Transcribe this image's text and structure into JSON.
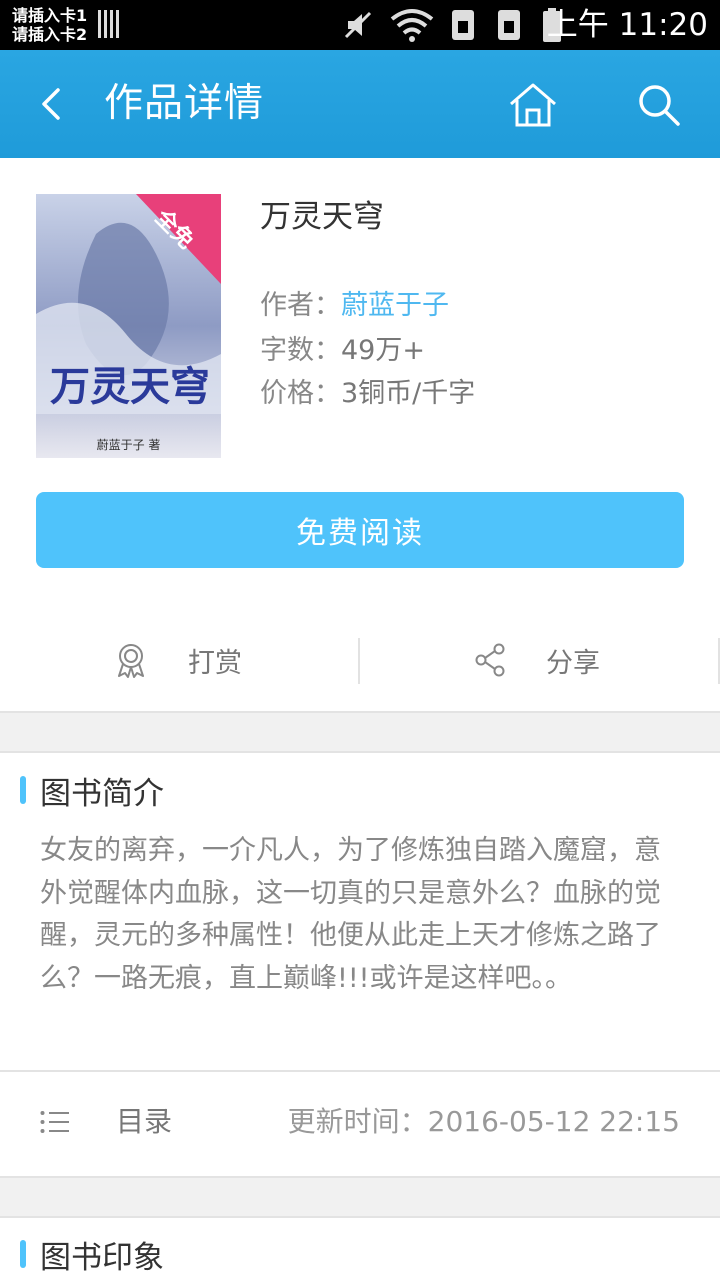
{
  "status": {
    "sim1": "请插入卡1",
    "sim2": "请插入卡2",
    "time": "上午 11:20"
  },
  "appbar": {
    "title": "作品详情",
    "icons": [
      "back-icon",
      "home-icon",
      "search-icon"
    ]
  },
  "book": {
    "name": "万灵天穹",
    "cover_badge": "全免",
    "cover_title": "万灵天穹",
    "cover_author_line": "蔚蓝于子 著",
    "author_label": "作者：",
    "author": "蔚蓝于子",
    "words_label": "字数：",
    "words": "49万+",
    "price_label": "价格：",
    "price": "3铜币/千字"
  },
  "read_button": "免费阅读",
  "actions": {
    "reward": "打赏",
    "share": "分享"
  },
  "intro": {
    "title": "图书简介",
    "text": "女友的离弃，一介凡人，为了修炼独自踏入魔窟，意外觉醒体内血脉，这一切真的只是意外么？血脉的觉醒，灵元的多种属性！他便从此走上天才修炼之路了么？一路无痕，直上巅峰!!!或许是这样吧。。"
  },
  "toc": {
    "label": "目录",
    "update": "更新时间：2016-05-12 22:15"
  },
  "impression": {
    "title": "图书印象"
  },
  "colors": {
    "primary": "#1f9bd9",
    "button": "#4fc3fb",
    "link": "#4fb8f0"
  }
}
